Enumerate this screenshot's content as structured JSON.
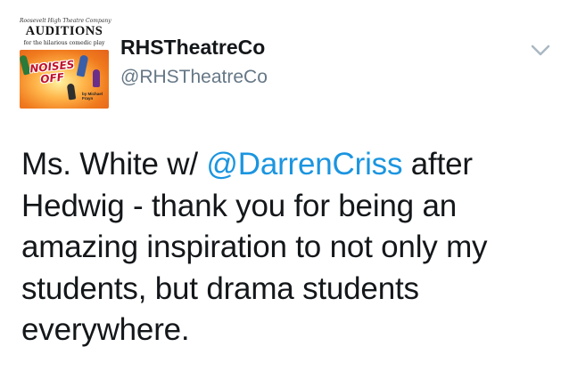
{
  "avatar": {
    "tiny_text": "Roosevelt High Theatre Company",
    "title": "AUDITIONS",
    "subtitle": "for the hilarious comedic play",
    "logo_line1": "NOISES",
    "logo_line2": "OFF",
    "credit": "by Michael Frayn"
  },
  "account": {
    "display_name": "RHSTheatreCo",
    "handle": "@RHSTheatreCo"
  },
  "menu": {
    "icon": "chevron-down-icon"
  },
  "tweet": {
    "part1": "Ms. White w/ ",
    "mention": "@DarrenCriss",
    "part2": " after Hedwig - thank you for being an amazing inspiration to not only my students, but drama students everywhere."
  },
  "colors": {
    "text": "#14171a",
    "secondary": "#657786",
    "link": "#1b95e0"
  }
}
